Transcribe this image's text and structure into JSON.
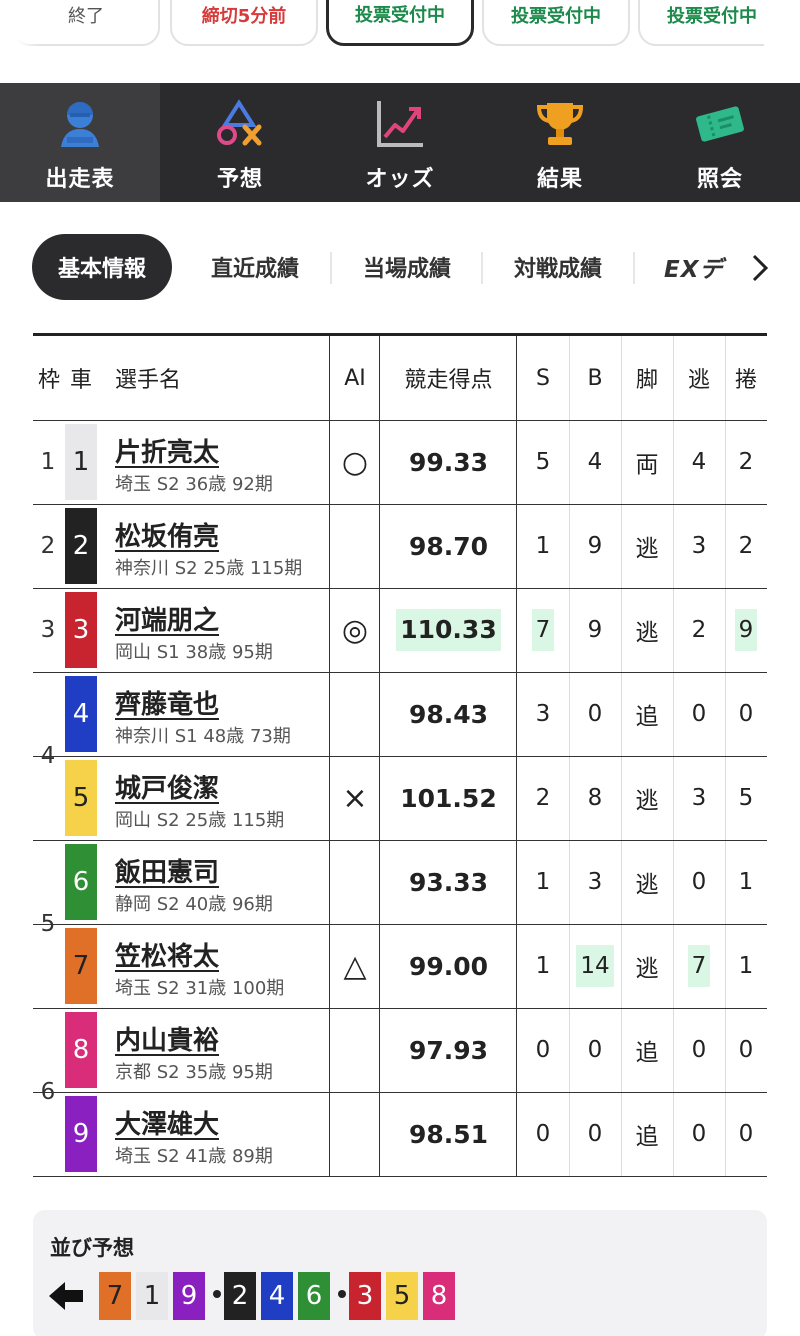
{
  "race_tabs": [
    {
      "label": "終了",
      "status": "end"
    },
    {
      "label": "締切5分前",
      "status": "warn"
    },
    {
      "label": "投票受付中",
      "status": "open",
      "selected": true
    },
    {
      "label": "投票受付中",
      "status": "open"
    },
    {
      "label": "投票受付中",
      "status": "open"
    }
  ],
  "main_nav": [
    {
      "label": "出走表",
      "icon": "person-icon",
      "active": true
    },
    {
      "label": "予想",
      "icon": "shapes-icon"
    },
    {
      "label": "オッズ",
      "icon": "chart-icon"
    },
    {
      "label": "結果",
      "icon": "trophy-icon"
    },
    {
      "label": "照会",
      "icon": "ticket-icon"
    }
  ],
  "sub_tabs": [
    {
      "label": "基本情報",
      "active": true
    },
    {
      "label": "直近成績"
    },
    {
      "label": "当場成績"
    },
    {
      "label": "対戦成績"
    },
    {
      "label": "EXデ"
    }
  ],
  "table": {
    "headers": {
      "waku": "枠",
      "car": "車",
      "name": "選手名",
      "ai": "AI",
      "score": "競走得点",
      "s": "S",
      "b": "B",
      "style": "脚",
      "nige": "逃",
      "makuri": "捲"
    },
    "rows": [
      {
        "waku": "1",
        "car": "1",
        "name": "片折亮太",
        "info": "埼玉 S2 36歳 92期",
        "ai": "○",
        "score": "99.33",
        "s": "5",
        "b": "4",
        "style": "両",
        "nige": "4",
        "makuri": "2"
      },
      {
        "waku": "2",
        "car": "2",
        "name": "松坂侑亮",
        "info": "神奈川 S2 25歳 115期",
        "ai": "",
        "score": "98.70",
        "s": "1",
        "b": "9",
        "style": "逃",
        "nige": "3",
        "makuri": "2"
      },
      {
        "waku": "3",
        "car": "3",
        "name": "河端朋之",
        "info": "岡山 S1 38歳 95期",
        "ai": "◎",
        "score": "110.33",
        "s": "7",
        "b": "9",
        "style": "逃",
        "nige": "2",
        "makuri": "9"
      },
      {
        "waku": "4",
        "car": "4",
        "name": "齊藤竜也",
        "info": "神奈川 S1 48歳 73期",
        "ai": "",
        "score": "98.43",
        "s": "3",
        "b": "0",
        "style": "追",
        "nige": "0",
        "makuri": "0"
      },
      {
        "waku": "4",
        "car": "5",
        "name": "城戸俊潔",
        "info": "岡山 S2 25歳 115期",
        "ai": "×",
        "score": "101.52",
        "s": "2",
        "b": "8",
        "style": "逃",
        "nige": "3",
        "makuri": "5"
      },
      {
        "waku": "5",
        "car": "6",
        "name": "飯田憲司",
        "info": "静岡 S2 40歳 96期",
        "ai": "",
        "score": "93.33",
        "s": "1",
        "b": "3",
        "style": "逃",
        "nige": "0",
        "makuri": "1"
      },
      {
        "waku": "5",
        "car": "7",
        "name": "笠松将太",
        "info": "埼玉 S2 31歳 100期",
        "ai": "△",
        "score": "99.00",
        "s": "1",
        "b": "14",
        "style": "逃",
        "nige": "7",
        "makuri": "1"
      },
      {
        "waku": "6",
        "car": "8",
        "name": "内山貴裕",
        "info": "京都 S2 35歳 95期",
        "ai": "",
        "score": "97.93",
        "s": "0",
        "b": "0",
        "style": "追",
        "nige": "0",
        "makuri": "0"
      },
      {
        "waku": "6",
        "car": "9",
        "name": "大澤雄大",
        "info": "埼玉 S2 41歳 89期",
        "ai": "",
        "score": "98.51",
        "s": "0",
        "b": "0",
        "style": "追",
        "nige": "0",
        "makuri": "0"
      }
    ],
    "highlights": {
      "score_row": 2,
      "s_row": 2,
      "makuri_row": 2,
      "b_row": 6,
      "nige_row": 6
    }
  },
  "line_prediction": {
    "title": "並び予想",
    "groups": [
      [
        "7",
        "1",
        "9"
      ],
      [
        "2",
        "4",
        "6"
      ],
      [
        "3",
        "5",
        "8"
      ]
    ]
  },
  "car_colors": {
    "1": {
      "bg": "#e8e8ea",
      "fg": "#222222"
    },
    "2": {
      "bg": "#222222",
      "fg": "#ffffff"
    },
    "3": {
      "bg": "#c8242f",
      "fg": "#ffffff"
    },
    "4": {
      "bg": "#1f3ec4",
      "fg": "#ffffff"
    },
    "5": {
      "bg": "#f6d24a",
      "fg": "#222222"
    },
    "6": {
      "bg": "#2e8f34",
      "fg": "#ffffff"
    },
    "7": {
      "bg": "#e07027",
      "fg": "#222222"
    },
    "8": {
      "bg": "#d92c79",
      "fg": "#ffffff"
    },
    "9": {
      "bg": "#8a20c0",
      "fg": "#ffffff"
    }
  },
  "colors": {
    "nav_bg": "#2b2b2d",
    "highlight": "#d9f7e4",
    "open_green": "#1b8a4a",
    "warn_red": "#d63a3a"
  }
}
